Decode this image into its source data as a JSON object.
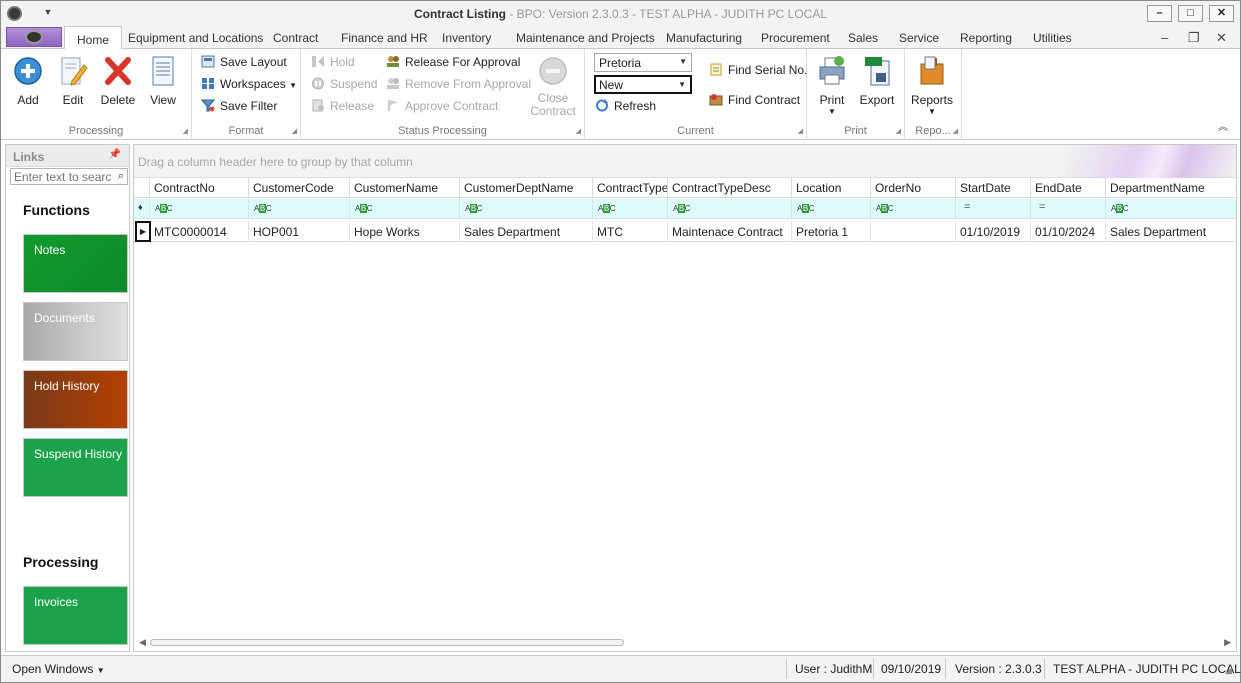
{
  "window": {
    "title_main": "Contract Listing",
    "title_sub": " - BPO: Version 2.3.0.3 - TEST ALPHA - JUDITH PC LOCAL",
    "minimize": "–",
    "maximize": "□",
    "close": "✕"
  },
  "tabs": [
    {
      "label": "Home"
    },
    {
      "label": "Equipment and Locations"
    },
    {
      "label": "Contract"
    },
    {
      "label": "Finance and HR"
    },
    {
      "label": "Inventory"
    },
    {
      "label": "Maintenance and Projects"
    },
    {
      "label": "Manufacturing"
    },
    {
      "label": "Procurement"
    },
    {
      "label": "Sales"
    },
    {
      "label": "Service"
    },
    {
      "label": "Reporting"
    },
    {
      "label": "Utilities"
    }
  ],
  "ribbon": {
    "processing": {
      "label": "Processing",
      "add": "Add",
      "edit": "Edit",
      "delete": "Delete",
      "view": "View"
    },
    "format": {
      "label": "Format",
      "save_layout": "Save Layout",
      "workspaces": "Workspaces",
      "save_filter": "Save Filter"
    },
    "status": {
      "label": "Status Processing",
      "hold": "Hold",
      "suspend": "Suspend",
      "release": "Release",
      "release_for_approval": "Release For Approval",
      "remove_from_approval": "Remove From Approval",
      "approve_contract": "Approve Contract",
      "close_contract_1": "Close",
      "close_contract_2": "Contract"
    },
    "current": {
      "label": "Current",
      "location_value": "Pretoria",
      "status_value": "New",
      "refresh": "Refresh",
      "find_serial": "Find Serial No.",
      "find_contract": "Find Contract"
    },
    "print": {
      "label": "Print",
      "print": "Print",
      "export": "Export"
    },
    "reports": {
      "label": "Repo...",
      "reports": "Reports"
    }
  },
  "links": {
    "title": "Links",
    "search_placeholder": "Enter text to search...",
    "functions_title": "Functions",
    "processing_title": "Processing",
    "tiles": [
      {
        "label": "Notes",
        "color": "#119a2e"
      },
      {
        "label": "Documents",
        "color": "#b3b3b3"
      },
      {
        "label": "Hold History",
        "color": "#8c3f17"
      },
      {
        "label": "Suspend History",
        "color": "#1ba24a"
      },
      {
        "label": "Invoices",
        "color": "#1ba24a"
      }
    ]
  },
  "grid": {
    "group_hint": "Drag a column header here to group by that column",
    "columns": [
      "ContractNo",
      "CustomerCode",
      "CustomerName",
      "CustomerDeptName",
      "ContractType",
      "ContractTypeDesc",
      "Location",
      "OrderNo",
      "StartDate",
      "EndDate",
      "DepartmentName"
    ],
    "filter_types": [
      "abc",
      "abc",
      "abc",
      "abc",
      "abc",
      "abc",
      "abc",
      "abc",
      "eq",
      "eq",
      "abc"
    ],
    "rows": [
      [
        "MTC0000014",
        "HOP001",
        "Hope Works",
        "Sales Department",
        "MTC",
        "Maintenace Contract",
        "Pretoria 1",
        "",
        "01/10/2019",
        "01/10/2024",
        "Sales Department"
      ]
    ]
  },
  "statusbar": {
    "open_windows": "Open Windows",
    "user": "User : JudithM",
    "date": "09/10/2019",
    "version": "Version : 2.3.0.3",
    "env": "TEST ALPHA - JUDITH PC LOCAL"
  }
}
